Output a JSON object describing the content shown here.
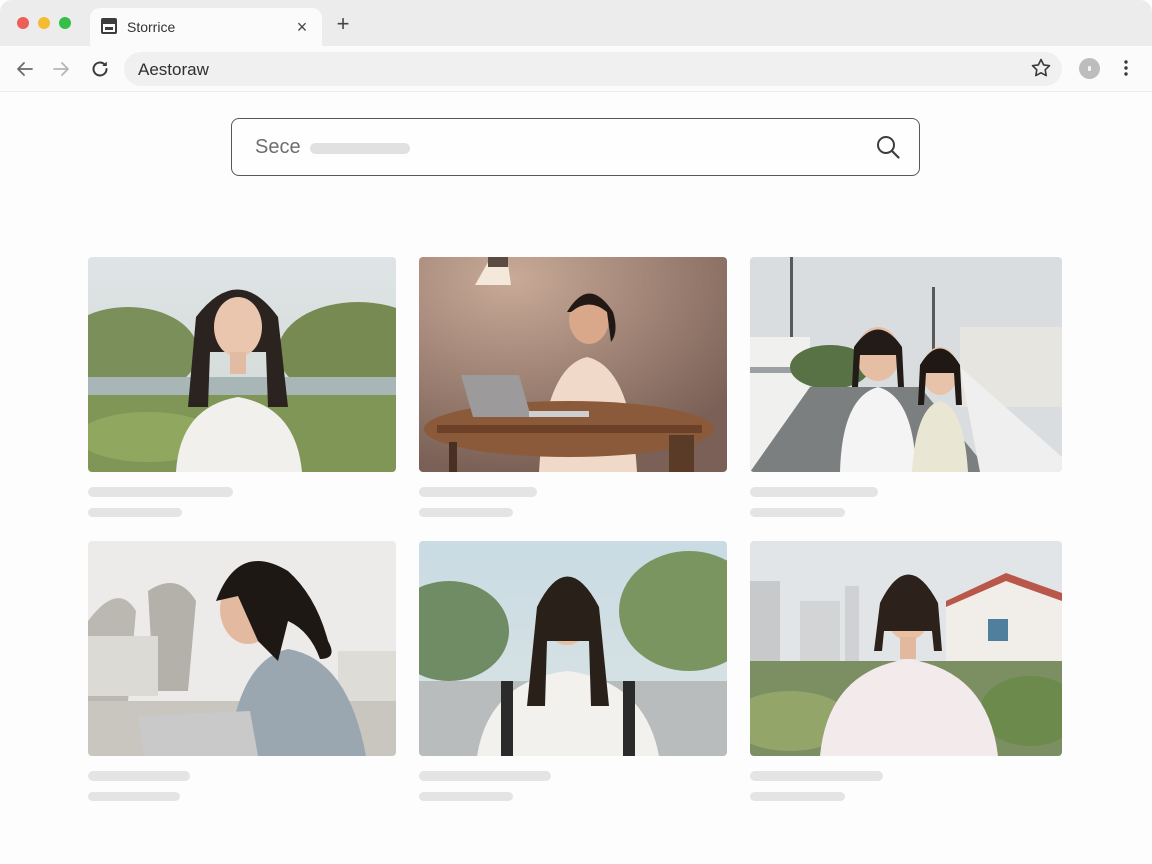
{
  "browser": {
    "tab": {
      "title": "Storrice",
      "icon": "window-icon"
    },
    "address": {
      "value": "Aestoraw"
    },
    "icons": [
      "back-icon",
      "forward-icon",
      "reload-icon",
      "star-icon",
      "profile-icon",
      "more-icon",
      "close-icon",
      "plus-icon"
    ]
  },
  "search": {
    "placeholder": "Sece",
    "icon": "search-icon"
  },
  "gallery": {
    "items": [
      {
        "description": "woman standing in a park"
      },
      {
        "description": "woman working on a laptop at a table"
      },
      {
        "description": "two girls on a rooftop"
      },
      {
        "description": "woman looking at a laptop outdoors"
      },
      {
        "description": "woman with a backpack on a street"
      },
      {
        "description": "woman in front of buildings and plants"
      }
    ]
  },
  "colors": {
    "tab_strip": "#ececec",
    "close": "#ec5f57",
    "minimize": "#f4bd31",
    "maximize": "#34c048"
  }
}
